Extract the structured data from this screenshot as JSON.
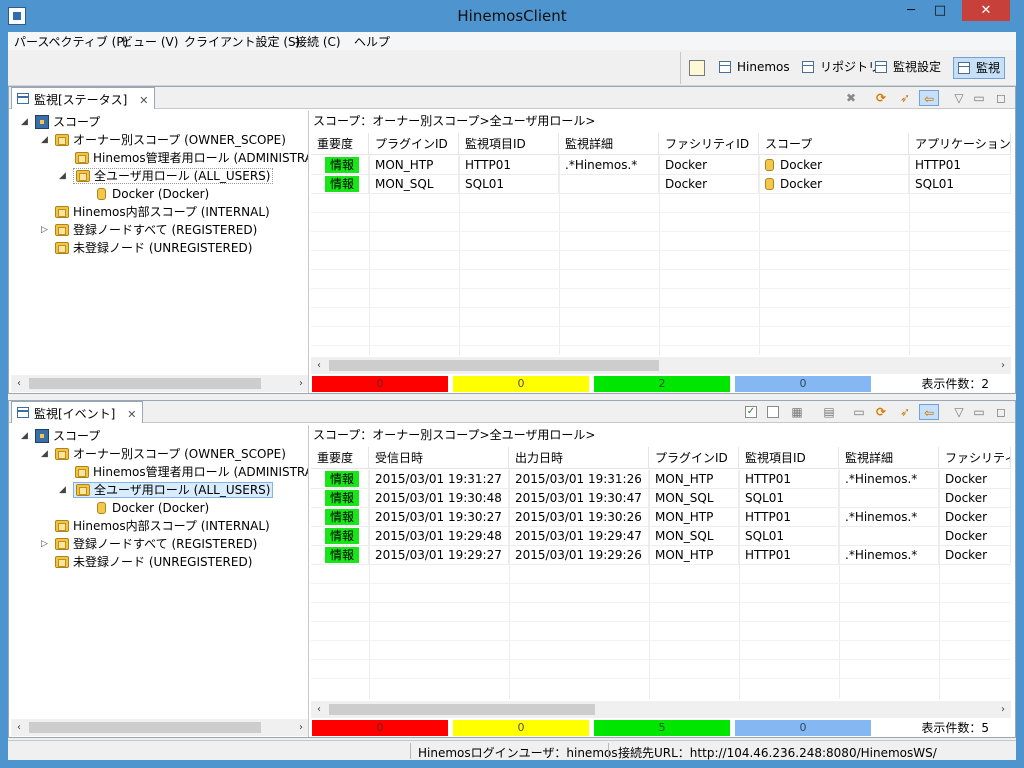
{
  "window": {
    "title": "HinemosClient",
    "minimize": "─",
    "maximize": "□",
    "close": "✕"
  },
  "menu": [
    "パースペクティブ (P)",
    "ビュー (V)",
    "クライアント設定 (S)",
    "接続 (C)",
    "ヘルプ"
  ],
  "perspectives": [
    "Hinemos",
    "リポジトリ",
    "監視設定",
    "監視"
  ],
  "status_view": {
    "tab_label": "監視[ステータス]",
    "close_glyph": "✕",
    "scope_path": "スコープ：オーナー別スコープ>全ユーザ用ロール>",
    "tree": [
      {
        "label": "スコープ",
        "toggle": "◢"
      },
      {
        "label": "オーナー別スコープ (OWNER_SCOPE)",
        "toggle": "◢"
      },
      {
        "label": "Hinemos管理者用ロール (ADMINISTRATOR)"
      },
      {
        "label": "全ユーザ用ロール (ALL_USERS)",
        "toggle": "◢"
      },
      {
        "label": "Docker (Docker)"
      },
      {
        "label": "Hinemos内部スコープ (INTERNAL)"
      },
      {
        "label": "登録ノードすべて (REGISTERED)",
        "toggle": "▷"
      },
      {
        "label": "未登録ノード (UNREGISTERED)"
      }
    ],
    "columns": [
      "重要度",
      "プラグインID",
      "監視項目ID",
      "監視詳細",
      "ファシリティID",
      "スコープ",
      "アプリケーション"
    ],
    "rows": [
      {
        "severity": "情報",
        "plugin": "MON_HTP",
        "item": "HTTP01",
        "detail": ".*Hinemos.*",
        "facility": "Docker",
        "scope": "Docker",
        "app": "HTTP01"
      },
      {
        "severity": "情報",
        "plugin": "MON_SQL",
        "item": "SQL01",
        "detail": "",
        "facility": "Docker",
        "scope": "Docker",
        "app": "SQL01"
      }
    ],
    "counts": {
      "critical": "0",
      "warning": "0",
      "info": "2",
      "unknown": "0"
    },
    "total": "表示件数：2"
  },
  "event_view": {
    "tab_label": "監視[イベント]",
    "close_glyph": "✕",
    "scope_path": "スコープ：オーナー別スコープ>全ユーザ用ロール>",
    "tree": [
      {
        "label": "スコープ",
        "toggle": "◢"
      },
      {
        "label": "オーナー別スコープ (OWNER_SCOPE)",
        "toggle": "◢"
      },
      {
        "label": "Hinemos管理者用ロール (ADMINISTRATOR)"
      },
      {
        "label": "全ユーザ用ロール (ALL_USERS)",
        "toggle": "◢"
      },
      {
        "label": "Docker (Docker)"
      },
      {
        "label": "Hinemos内部スコープ (INTERNAL)"
      },
      {
        "label": "登録ノードすべて (REGISTERED)",
        "toggle": "▷"
      },
      {
        "label": "未登録ノード (UNREGISTERED)"
      }
    ],
    "columns": [
      "重要度",
      "受信日時",
      "出力日時",
      "プラグインID",
      "監視項目ID",
      "監視詳細",
      "ファシリティID"
    ],
    "rows": [
      {
        "severity": "情報",
        "received": "2015/03/01 19:31:27",
        "output": "2015/03/01 19:31:26",
        "plugin": "MON_HTP",
        "item": "HTTP01",
        "detail": ".*Hinemos.*",
        "facility": "Docker"
      },
      {
        "severity": "情報",
        "received": "2015/03/01 19:30:48",
        "output": "2015/03/01 19:30:47",
        "plugin": "MON_SQL",
        "item": "SQL01",
        "detail": "",
        "facility": "Docker"
      },
      {
        "severity": "情報",
        "received": "2015/03/01 19:30:27",
        "output": "2015/03/01 19:30:26",
        "plugin": "MON_HTP",
        "item": "HTTP01",
        "detail": ".*Hinemos.*",
        "facility": "Docker"
      },
      {
        "severity": "情報",
        "received": "2015/03/01 19:29:48",
        "output": "2015/03/01 19:29:47",
        "plugin": "MON_SQL",
        "item": "SQL01",
        "detail": "",
        "facility": "Docker"
      },
      {
        "severity": "情報",
        "received": "2015/03/01 19:29:27",
        "output": "2015/03/01 19:29:26",
        "plugin": "MON_HTP",
        "item": "HTTP01",
        "detail": ".*Hinemos.*",
        "facility": "Docker"
      }
    ],
    "counts": {
      "critical": "0",
      "warning": "0",
      "info": "5",
      "unknown": "0"
    },
    "total": "表示件数：5"
  },
  "statusbar": {
    "login_user": "Hinemosログインユーザ：hinemos",
    "endpoint": "接続先URL：http://104.46.236.248:8080/HinemosWS/"
  },
  "colors": {
    "critical": "#ff0000",
    "warning": "#ffff00",
    "info": "#00e600",
    "unknown": "#85b8f2",
    "severity_info": "#19e619"
  }
}
